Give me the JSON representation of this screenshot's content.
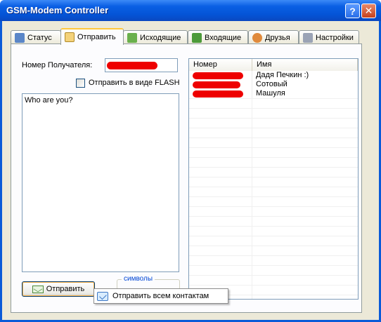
{
  "window": {
    "title": "GSM-Modem Controller",
    "help_label": "?",
    "close_label": "✕"
  },
  "tabs": [
    {
      "label": "Статус",
      "icon": "status-icon",
      "active": false
    },
    {
      "label": "Отправить",
      "icon": "compose-icon",
      "active": true
    },
    {
      "label": "Исходящие",
      "icon": "outbox-icon",
      "active": false
    },
    {
      "label": "Входящие",
      "icon": "inbox-icon",
      "active": false
    },
    {
      "label": "Друзья",
      "icon": "friends-icon",
      "active": false
    },
    {
      "label": "Настройки",
      "icon": "wrench-icon",
      "active": false
    }
  ],
  "send": {
    "recipient_label": "Номер Получателя:",
    "flash_label": "Отправить в виде FLASH",
    "flash_checked": false,
    "message": "Who are you?",
    "symbols_label": "символы",
    "send_button": "Отправить"
  },
  "contacts": {
    "columns": [
      "Номер",
      "Имя"
    ],
    "rows": [
      {
        "name": "Дадя Печкин :)"
      },
      {
        "name": "Сотовый"
      },
      {
        "name": "Машуля"
      }
    ]
  },
  "context_menu": {
    "item": "Отправить всем контактам"
  },
  "colors": {
    "titlebar": "#0a5ad8",
    "client": "#ece9d8",
    "redaction": "#ee0000",
    "active_tab_accent": "#ffc83c"
  }
}
